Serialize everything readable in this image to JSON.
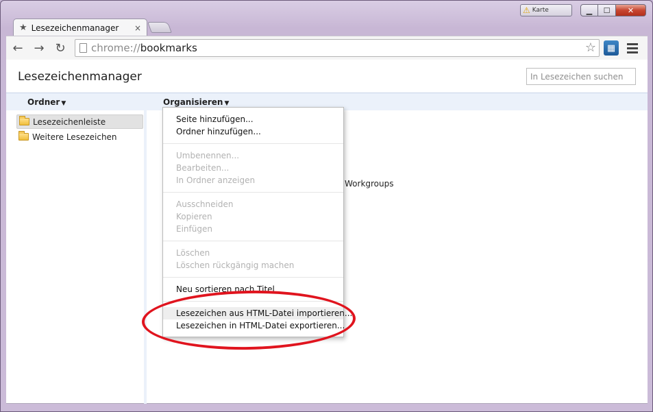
{
  "window": {
    "controls": {
      "minimize": "▁",
      "maximize": "☐",
      "close": "✕"
    },
    "extension_indicator_label": "Karte"
  },
  "tab": {
    "title": "Lesezeichenmanager",
    "close": "×"
  },
  "toolbar": {
    "back": "←",
    "forward": "→",
    "reload": "↻",
    "url_scheme": "chrome://",
    "url_host": "bookmarks",
    "star": "☆"
  },
  "page": {
    "title": "Lesezeichenmanager",
    "search_placeholder": "In Lesezeichen suchen",
    "folders_menu": "Ordner",
    "organize_menu": "Organisieren",
    "tree": [
      {
        "label": "Lesezeichenleiste",
        "selected": true
      },
      {
        "label": "Weitere Lesezeichen",
        "selected": false
      }
    ],
    "list_item_partial": "Workgroups"
  },
  "organize_menu": {
    "groups": [
      [
        {
          "label": "Seite hinzufügen...",
          "enabled": true
        },
        {
          "label": "Ordner hinzufügen...",
          "enabled": true
        }
      ],
      [
        {
          "label": "Umbenennen...",
          "enabled": false
        },
        {
          "label": "Bearbeiten...",
          "enabled": false
        },
        {
          "label": "In Ordner anzeigen",
          "enabled": false
        }
      ],
      [
        {
          "label": "Ausschneiden",
          "enabled": false
        },
        {
          "label": "Kopieren",
          "enabled": false
        },
        {
          "label": "Einfügen",
          "enabled": false
        }
      ],
      [
        {
          "label": "Löschen",
          "enabled": false
        },
        {
          "label": "Löschen rückgängig machen",
          "enabled": false
        }
      ],
      [
        {
          "label": "Neu sortieren nach Titel",
          "enabled": true
        }
      ],
      [
        {
          "label": "Lesezeichen aus HTML-Datei importieren...",
          "enabled": true,
          "hovered": true
        },
        {
          "label": "Lesezeichen in HTML-Datei exportieren...",
          "enabled": true
        }
      ]
    ]
  },
  "colors": {
    "annotation": "#e0141e",
    "header_bar": "#ebf1fa",
    "frame": "#c8b7d5"
  }
}
